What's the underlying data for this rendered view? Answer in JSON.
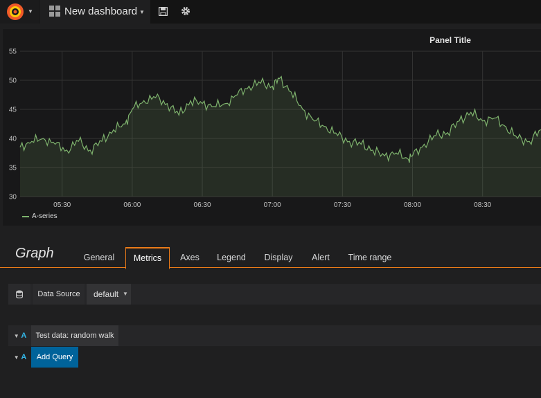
{
  "navbar": {
    "dashboard_title": "New dashboard"
  },
  "panel": {
    "title": "Panel Title"
  },
  "chart_data": {
    "type": "area",
    "title": "Panel Title",
    "xlabel": "",
    "ylabel": "",
    "x_ticks": [
      "05:30",
      "06:00",
      "06:30",
      "07:00",
      "07:30",
      "08:00",
      "08:30"
    ],
    "y_ticks": [
      30,
      35,
      40,
      45,
      50,
      55
    ],
    "ylim": [
      30,
      55
    ],
    "xlim": [
      "05:12",
      "08:55"
    ],
    "grid": true,
    "legend_position": "bottom-left",
    "series": [
      {
        "name": "A-series",
        "color": "#7eb26d",
        "x": [
          "05:12",
          "05:17",
          "05:22",
          "05:27",
          "05:32",
          "05:37",
          "05:42",
          "05:47",
          "05:52",
          "05:57",
          "06:00",
          "06:05",
          "06:10",
          "06:15",
          "06:20",
          "06:25",
          "06:30",
          "06:35",
          "06:40",
          "06:45",
          "06:50",
          "06:55",
          "07:00",
          "07:03",
          "07:08",
          "07:13",
          "07:18",
          "07:23",
          "07:28",
          "07:33",
          "07:38",
          "07:43",
          "07:48",
          "07:53",
          "07:58",
          "08:00",
          "08:05",
          "08:10",
          "08:15",
          "08:20",
          "08:25",
          "08:30",
          "08:35",
          "08:40",
          "08:45",
          "08:50",
          "08:55"
        ],
        "y": [
          38.5,
          39.5,
          40,
          39,
          38,
          39.5,
          38,
          39.5,
          41.5,
          42.5,
          45,
          46.5,
          47,
          46,
          44,
          46.5,
          46,
          45.5,
          46,
          47.5,
          49,
          49.5,
          49,
          50.3,
          48,
          45,
          43,
          42,
          40.5,
          39.5,
          39,
          38,
          37,
          37.5,
          36.5,
          37,
          39,
          40.5,
          41,
          43,
          44.5,
          43,
          43.5,
          42,
          40,
          39.5,
          41.5
        ]
      }
    ]
  },
  "editor": {
    "title": "Graph",
    "tabs": [
      "General",
      "Metrics",
      "Axes",
      "Legend",
      "Display",
      "Alert",
      "Time range"
    ],
    "active_tab": "Metrics"
  },
  "datasource": {
    "label": "Data Source",
    "value": "default"
  },
  "queries": [
    {
      "ref": "A",
      "label": "Test data: random walk"
    }
  ],
  "add_query": {
    "ref": "A",
    "label": "Add Query"
  }
}
